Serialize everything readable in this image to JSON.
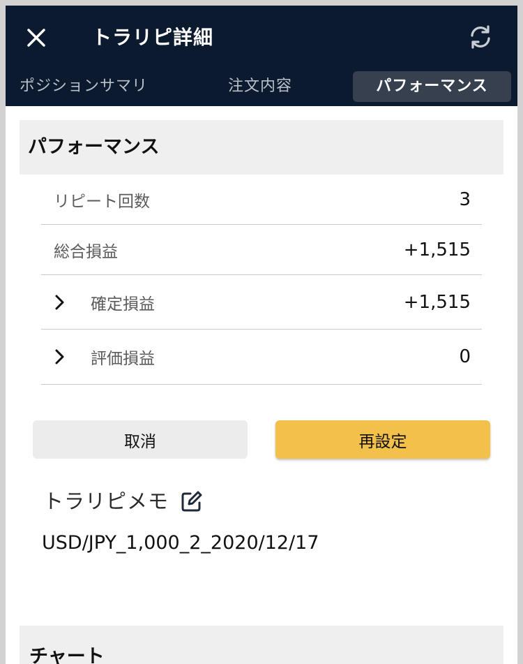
{
  "header": {
    "title": "トラリピ詳細"
  },
  "tabs": [
    {
      "label": "ポジションサマリ",
      "active": false
    },
    {
      "label": "注文内容",
      "active": false
    },
    {
      "label": "パフォーマンス",
      "active": true
    }
  ],
  "performance": {
    "title": "パフォーマンス",
    "rows": [
      {
        "label": "リピート回数",
        "value": "3",
        "expandable": false
      },
      {
        "label": "総合損益",
        "value": "+1,515",
        "expandable": false
      },
      {
        "label": "確定損益",
        "value": "+1,515",
        "expandable": true
      },
      {
        "label": "評価損益",
        "value": "0",
        "expandable": true
      }
    ]
  },
  "actions": {
    "cancel_label": "取消",
    "reset_label": "再設定"
  },
  "memo": {
    "title": "トラリピメモ",
    "text": "USD/JPY_1,000_2_2020/12/17"
  },
  "chart": {
    "title": "チャート"
  },
  "colors": {
    "appbar": "#0b1a2e",
    "active_tab": "#36404e",
    "accent_button": "#f3c04a",
    "section_bg": "#efefef"
  },
  "icons": {
    "close": "close-icon",
    "refresh": "refresh-icon",
    "chevron": "chevron-right-icon",
    "edit": "edit-icon"
  }
}
